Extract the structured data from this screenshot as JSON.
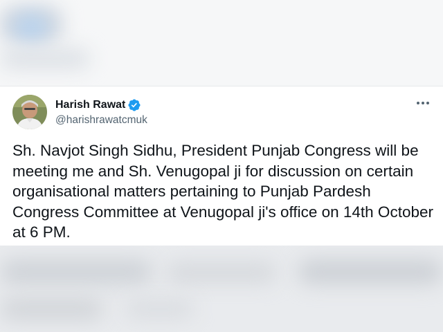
{
  "tweet": {
    "author": {
      "display_name": "Harish Rawat",
      "handle": "@harishrawatcmuk",
      "verified": true
    },
    "text": "Sh. Navjot Singh Sidhu, President Punjab Congress will be meeting me and Sh. Venugopal ji for discussion on certain organisational matters pertaining to Punjab Pardesh Congress Committee at Venugopal ji's office on 14th October at 6 PM."
  },
  "icons": {
    "verified": "verified-badge-icon",
    "more": "more-options-icon"
  },
  "colors": {
    "verified_blue": "#1d9bf0",
    "text_primary": "#0f1419",
    "text_secondary": "#536471"
  }
}
